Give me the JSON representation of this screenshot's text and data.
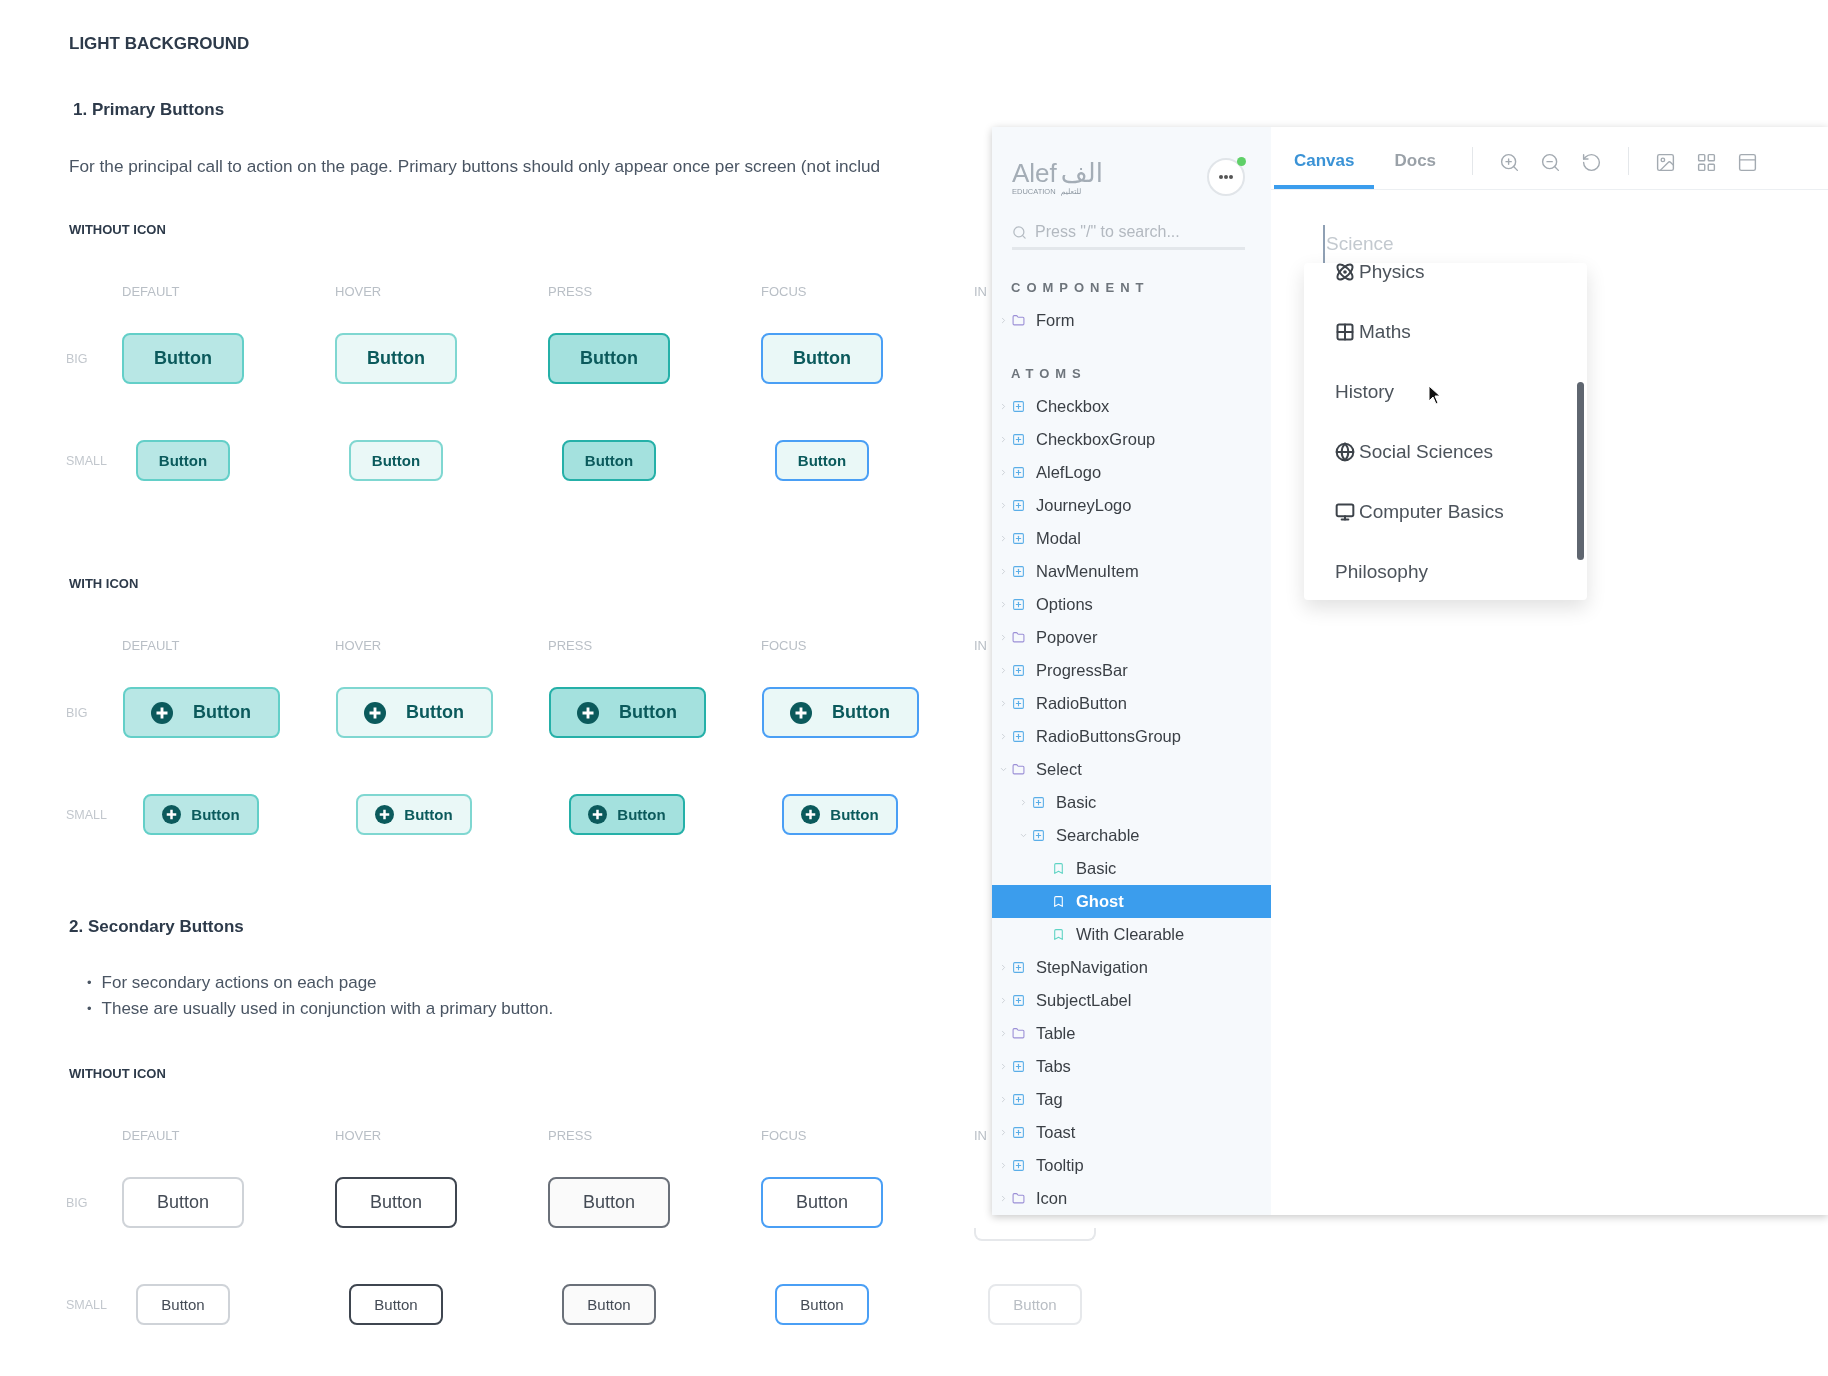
{
  "page_title": "LIGHT BACKGROUND",
  "sections": [
    {
      "heading": "1. Primary Buttons",
      "kind": "primary",
      "paragraph": "For the principal call to action on the page. Primary buttons should only appear once per screen (not includ",
      "groups": [
        {
          "title": "WITHOUT ICON",
          "icon": false,
          "columns": [
            "DEFAULT",
            "HOVER",
            "PRESS",
            "FOCUS",
            "IN"
          ],
          "rows": [
            {
              "size_label": "BIG",
              "kind": "big",
              "buttons": [
                {
                  "kind": "default",
                  "label": "Button"
                },
                {
                  "kind": "hover",
                  "label": "Button"
                },
                {
                  "kind": "press",
                  "label": "Button"
                },
                {
                  "kind": "focus",
                  "label": "Button"
                }
              ]
            },
            {
              "size_label": "SMALL",
              "kind": "small",
              "buttons": [
                {
                  "kind": "default",
                  "label": "Button"
                },
                {
                  "kind": "hover",
                  "label": "Button"
                },
                {
                  "kind": "press",
                  "label": "Button"
                },
                {
                  "kind": "focus",
                  "label": "Button"
                }
              ]
            }
          ]
        },
        {
          "title": "WITH ICON",
          "icon": true,
          "columns": [
            "DEFAULT",
            "HOVER",
            "PRESS",
            "FOCUS",
            "IN"
          ],
          "rows": [
            {
              "size_label": "BIG",
              "kind": "big",
              "buttons": [
                {
                  "kind": "default",
                  "label": "Button"
                },
                {
                  "kind": "hover",
                  "label": "Button"
                },
                {
                  "kind": "press",
                  "label": "Button"
                },
                {
                  "kind": "focus",
                  "label": "Button"
                }
              ]
            },
            {
              "size_label": "SMALL",
              "kind": "small",
              "buttons": [
                {
                  "kind": "default",
                  "label": "Button"
                },
                {
                  "kind": "hover",
                  "label": "Button"
                },
                {
                  "kind": "press",
                  "label": "Button"
                },
                {
                  "kind": "focus",
                  "label": "Button"
                }
              ]
            }
          ]
        }
      ]
    },
    {
      "heading": "2. Secondary Buttons",
      "kind": "secondary",
      "bullets": [
        {
          "marker": "•",
          "text": "For secondary actions on each page"
        },
        {
          "marker": "•",
          "text": "These are usually used in conjunction with a primary button."
        }
      ],
      "groups": [
        {
          "title": "WITHOUT ICON",
          "icon": false,
          "columns": [
            "DEFAULT",
            "HOVER",
            "PRESS",
            "FOCUS",
            "IN"
          ],
          "rows": [
            {
              "size_label": "BIG",
              "kind": "big",
              "buttons": [
                {
                  "kind": "default",
                  "label": "Button"
                },
                {
                  "kind": "hover",
                  "label": "Button"
                },
                {
                  "kind": "press",
                  "label": "Button"
                },
                {
                  "kind": "focus",
                  "label": "Button"
                },
                {
                  "kind": "disabled"
                }
              ]
            },
            {
              "size_label": "SMALL",
              "kind": "small",
              "buttons": [
                {
                  "kind": "default",
                  "label": "Button"
                },
                {
                  "kind": "hover",
                  "label": "Button"
                },
                {
                  "kind": "press",
                  "label": "Button"
                },
                {
                  "kind": "focus",
                  "label": "Button"
                },
                {
                  "kind": "disabled",
                  "label": "Button"
                }
              ]
            }
          ]
        }
      ]
    }
  ],
  "storybook": {
    "logo": {
      "latin": "Alef",
      "arabic": "الف",
      "sub_latin": "EDUCATION",
      "sub_arabic": "للتعليم"
    },
    "search": {
      "placeholder": "Press \"/\" to search..."
    },
    "sidebar_sections": [
      {
        "title": "COMPONENT",
        "items": [
          {
            "label": "Form",
            "kind": "folder",
            "expanded": false,
            "selected": false
          }
        ]
      },
      {
        "title": "ATOMS",
        "items": [
          {
            "label": "Checkbox",
            "kind": "component",
            "expanded": false,
            "selected": false
          },
          {
            "label": "CheckboxGroup",
            "kind": "component",
            "expanded": false,
            "selected": false
          },
          {
            "label": "AlefLogo",
            "kind": "component",
            "expanded": false,
            "selected": false
          },
          {
            "label": "JourneyLogo",
            "kind": "component",
            "expanded": false,
            "selected": false
          },
          {
            "label": "Modal",
            "kind": "component",
            "expanded": false,
            "selected": false
          },
          {
            "label": "NavMenuItem",
            "kind": "component",
            "expanded": false,
            "selected": false
          },
          {
            "label": "Options",
            "kind": "component",
            "expanded": false,
            "selected": false
          },
          {
            "label": "Popover",
            "kind": "folder",
            "expanded": false,
            "selected": false
          },
          {
            "label": "ProgressBar",
            "kind": "component",
            "expanded": false,
            "selected": false
          },
          {
            "label": "RadioButton",
            "kind": "component",
            "expanded": false,
            "selected": false
          },
          {
            "label": "RadioButtonsGroup",
            "kind": "component",
            "expanded": false,
            "selected": false
          },
          {
            "label": "Select",
            "kind": "folder",
            "expanded": true,
            "selected": false,
            "children": [
              {
                "label": "Basic",
                "kind": "component",
                "expanded": false,
                "selected": false
              },
              {
                "label": "Searchable",
                "kind": "component",
                "expanded": true,
                "selected": false,
                "children": [
                  {
                    "label": "Basic",
                    "kind": "story",
                    "selected": false
                  },
                  {
                    "label": "Ghost",
                    "kind": "story",
                    "selected": true
                  },
                  {
                    "label": "With Clearable",
                    "kind": "story",
                    "selected": false
                  }
                ]
              }
            ]
          },
          {
            "label": "StepNavigation",
            "kind": "component",
            "expanded": false,
            "selected": false
          },
          {
            "label": "SubjectLabel",
            "kind": "component",
            "expanded": false,
            "selected": false
          },
          {
            "label": "Table",
            "kind": "folder",
            "expanded": false,
            "selected": false
          },
          {
            "label": "Tabs",
            "kind": "component",
            "expanded": false,
            "selected": false
          },
          {
            "label": "Tag",
            "kind": "component",
            "expanded": false,
            "selected": false
          },
          {
            "label": "Toast",
            "kind": "component",
            "expanded": false,
            "selected": false
          },
          {
            "label": "Tooltip",
            "kind": "component",
            "expanded": false,
            "selected": false
          },
          {
            "label": "Icon",
            "kind": "folder",
            "expanded": false,
            "selected": false
          }
        ]
      }
    ],
    "tabs": [
      {
        "label": "Canvas",
        "selected": true
      },
      {
        "label": "Docs",
        "selected": false
      }
    ],
    "select": {
      "placeholder": "Science"
    },
    "options": [
      {
        "label": "Physics",
        "has_icon": true
      },
      {
        "label": "Maths",
        "has_icon": true
      },
      {
        "label": "History",
        "has_icon": false
      },
      {
        "label": "Social Sciences",
        "has_icon": true
      },
      {
        "label": "Computer Basics",
        "has_icon": true
      },
      {
        "label": "Philosophy",
        "has_icon": false
      }
    ]
  }
}
